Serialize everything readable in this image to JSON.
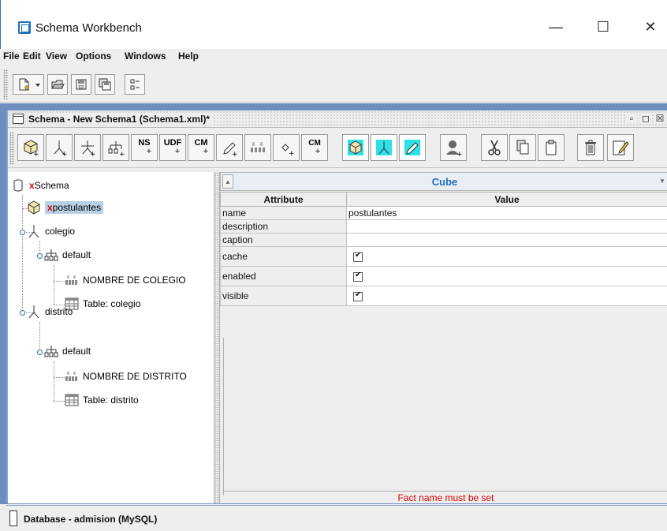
{
  "window": {
    "title": "Schema Workbench",
    "minimize": "—",
    "maximize": "☐",
    "close": "✕"
  },
  "menu": [
    {
      "label": "File",
      "mnemonic": "F"
    },
    {
      "label": "Edit",
      "mnemonic": "E"
    },
    {
      "label": "View",
      "mnemonic": "V"
    },
    {
      "label": "Options",
      "mnemonic": "O"
    },
    {
      "label": "Windows",
      "mnemonic": "W"
    },
    {
      "label": "Help",
      "mnemonic": "H"
    }
  ],
  "main_toolbar": {
    "buttons": [
      "new-icon",
      "dropdown-icon",
      "open-icon",
      "save-icon",
      "save-as-icon",
      "preferences-icon"
    ]
  },
  "schema_frame": {
    "title": "Schema - New Schema1 (Schema1.xml)*",
    "controls": [
      "restore-icon",
      "maximize-icon",
      "close-icon"
    ]
  },
  "schema_toolbar": {
    "labels": {
      "ns": "NS",
      "udf": "UDF",
      "cm1": "CM",
      "cm2": "CM",
      "plus": "+"
    }
  },
  "tree": {
    "root": {
      "prefix": "x",
      "label": "Schema"
    },
    "cube": {
      "prefix": "x",
      "label": "postulantes"
    },
    "dim1": "colegio",
    "dim1_hier": "default",
    "dim1_level": "NOMBRE DE COLEGIO",
    "dim1_table": "Table: colegio",
    "dim2": "distrito",
    "dim2_hier": "default",
    "dim2_level": "NOMBRE DE DISTRITO",
    "dim2_table": "Table: distrito"
  },
  "properties": {
    "header": "Cube",
    "col_attr": "Attribute",
    "col_value": "Value",
    "rows": [
      {
        "attr": "name",
        "value": "postulantes"
      },
      {
        "attr": "description",
        "value": ""
      },
      {
        "attr": "caption",
        "value": ""
      },
      {
        "attr": "cache",
        "checked": true
      },
      {
        "attr": "enabled",
        "checked": true
      },
      {
        "attr": "visible",
        "checked": true
      }
    ]
  },
  "status": "Fact name must be set",
  "db_frame": {
    "label": "Database - admision (MySQL)"
  }
}
